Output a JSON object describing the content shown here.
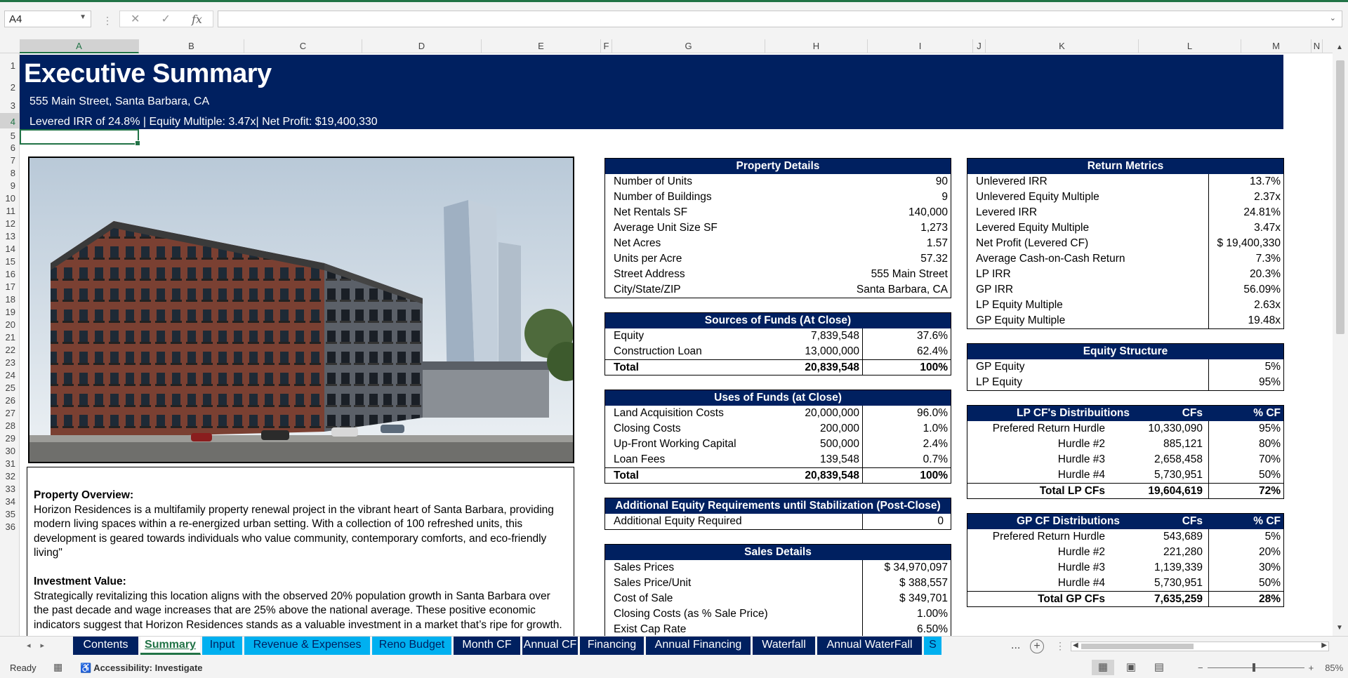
{
  "formula_bar": {
    "cell_ref": "A4",
    "cancel_icon": "✕",
    "enter_icon": "✓",
    "fx_label": "fx",
    "content": ""
  },
  "columns": [
    "A",
    "B",
    "C",
    "D",
    "E",
    "F",
    "G",
    "H",
    "I",
    "J",
    "K",
    "L",
    "M",
    "N"
  ],
  "rows": [
    "1",
    "2",
    "3",
    "4",
    "5",
    "6",
    "7",
    "8",
    "9",
    "10",
    "11",
    "12",
    "13",
    "14",
    "15",
    "16",
    "17",
    "18",
    "19",
    "20",
    "21",
    "22",
    "23",
    "24",
    "25",
    "26",
    "27",
    "28",
    "29",
    "30",
    "31",
    "32",
    "33",
    "34",
    "35",
    "36"
  ],
  "banner": {
    "title": "Executive Summary",
    "address": "555 Main Street, Santa Barbara, CA",
    "summary": "Levered IRR of 24.8% | Equity Multiple: 3.47x| Net Profit: $19,400,330"
  },
  "overview": {
    "heading": "Property Overview:",
    "body": "Horizon Residences is a multifamily property renewal project in the vibrant heart of Santa Barbara, providing modern living spaces within a re-energized urban setting. With a collection of 100 refreshed units, this development is geared towards individuals who value community, contemporary comforts, and eco-friendly living\"",
    "heading2": "Investment Value:",
    "body2": "Strategically revitalizing this location aligns with the observed 20% population growth in Santa Barbara over the past decade and wage increases that are 25% above the national average. These positive economic indicators suggest that Horizon Residences stands as a valuable investment in a market that’s ripe for growth."
  },
  "property_details": {
    "title": "Property Details",
    "rows": [
      {
        "label": "Number of Units",
        "value": "90"
      },
      {
        "label": "Number of Buildings",
        "value": "9"
      },
      {
        "label": "Net Rentals SF",
        "value": "140,000"
      },
      {
        "label": "Average Unit Size SF",
        "value": "1,273"
      },
      {
        "label": "Net Acres",
        "value": "1.57"
      },
      {
        "label": "Units per Acre",
        "value": "57.32"
      },
      {
        "label": "Street Address",
        "value": "555 Main Street"
      },
      {
        "label": "City/State/ZIP",
        "value": "Santa Barbara, CA"
      }
    ]
  },
  "sources": {
    "title": "Sources of Funds (At Close)",
    "rows": [
      {
        "label": "Equity",
        "amount": "7,839,548",
        "pct": "37.6%"
      },
      {
        "label": "Construction Loan",
        "amount": "13,000,000",
        "pct": "62.4%"
      },
      {
        "label": "Total",
        "amount": "20,839,548",
        "pct": "100%"
      }
    ]
  },
  "uses": {
    "title": "Uses of Funds (at Close)",
    "rows": [
      {
        "label": "Land Acquisition Costs",
        "amount": "20,000,000",
        "pct": "96.0%"
      },
      {
        "label": "Closing Costs",
        "amount": "200,000",
        "pct": "1.0%"
      },
      {
        "label": "Up-Front Working Capital",
        "amount": "500,000",
        "pct": "2.4%"
      },
      {
        "label": "Loan Fees",
        "amount": "139,548",
        "pct": "0.7%"
      },
      {
        "label": "Total",
        "amount": "20,839,548",
        "pct": "100%"
      }
    ]
  },
  "additional_equity": {
    "title": "Additional Equity Requirements until Stabilization (Post-Close)",
    "label": "Additional Equity Required",
    "value": "0"
  },
  "sales": {
    "title": "Sales Details",
    "rows": [
      {
        "label": "Sales Prices",
        "value": "$ 34,970,097"
      },
      {
        "label": "Sales Price/Unit",
        "value": "$ 388,557"
      },
      {
        "label": "Cost of Sale",
        "value": "$ 349,701"
      },
      {
        "label": "Closing Costs (as % Sale Price)",
        "value": "1.00%"
      },
      {
        "label": "Exist Cap Rate",
        "value": "6.50%"
      }
    ]
  },
  "returns": {
    "title": "Return Metrics",
    "rows": [
      {
        "label": "Unlevered IRR",
        "value": "13.7%"
      },
      {
        "label": "Unlevered Equity Multiple",
        "value": "2.37x"
      },
      {
        "label": "Levered IRR",
        "value": "24.81%"
      },
      {
        "label": "Levered Equity Multiple",
        "value": "3.47x"
      },
      {
        "label": "Net Profit (Levered CF)",
        "value": "$ 19,400,330"
      },
      {
        "label": "Average Cash-on-Cash Return",
        "value": "7.3%"
      },
      {
        "label": "LP IRR",
        "value": "20.3%"
      },
      {
        "label": "GP  IRR",
        "value": "56.09%"
      },
      {
        "label": "LP Equity Multiple",
        "value": "2.63x"
      },
      {
        "label": "GP Equity Multiple",
        "value": "19.48x"
      }
    ]
  },
  "equity_structure": {
    "title": "Equity Structure",
    "rows": [
      {
        "label": "GP Equity",
        "value": "5%"
      },
      {
        "label": "LP Equity",
        "value": "95%"
      }
    ]
  },
  "lp_dist": {
    "title": "LP CF's Distribuitions",
    "col_cf": "CFs",
    "col_pct": "% CF",
    "rows": [
      {
        "label": "Prefered  Return Hurdle",
        "cf": "10,330,090",
        "pct": "95%"
      },
      {
        "label": "Hurdle #2",
        "cf": "885,121",
        "pct": "80%"
      },
      {
        "label": "Hurdle #3",
        "cf": "2,658,458",
        "pct": "70%"
      },
      {
        "label": "Hurdle #4",
        "cf": "5,730,951",
        "pct": "50%"
      }
    ],
    "total": {
      "label": "Total LP CFs",
      "cf": "19,604,619",
      "pct": "72%"
    }
  },
  "gp_dist": {
    "title": "GP CF Distributions",
    "col_cf": "CFs",
    "col_pct": "% CF",
    "rows": [
      {
        "label": "Prefered  Return Hurdle",
        "cf": "543,689",
        "pct": "5%"
      },
      {
        "label": "Hurdle #2",
        "cf": "221,280",
        "pct": "20%"
      },
      {
        "label": "Hurdle #3",
        "cf": "1,139,339",
        "pct": "30%"
      },
      {
        "label": "Hurdle #4",
        "cf": "5,730,951",
        "pct": "50%"
      }
    ],
    "total": {
      "label": "Total GP CFs",
      "cf": "7,635,259",
      "pct": "28%"
    }
  },
  "tabs": [
    {
      "label": "Contents",
      "style": "navy"
    },
    {
      "label": "Summary",
      "style": "active"
    },
    {
      "label": "Input",
      "style": "cyan"
    },
    {
      "label": "Revenue & Expenses",
      "style": "cyan"
    },
    {
      "label": "Reno Budget",
      "style": "cyan"
    },
    {
      "label": "Month CF",
      "style": "navy"
    },
    {
      "label": "Annual CF",
      "style": "navy"
    },
    {
      "label": "Financing",
      "style": "navy"
    },
    {
      "label": "Annual Financing",
      "style": "navy"
    },
    {
      "label": "Waterfall",
      "style": "navy"
    },
    {
      "label": "Annual WaterFall",
      "style": "navy"
    },
    {
      "label": "S",
      "style": "cyan"
    }
  ],
  "tabs_more": "...",
  "status": {
    "ready": "Ready",
    "accessibility": "Accessibility: Investigate",
    "zoom": "85%",
    "zoom_minus": "−",
    "zoom_plus": "+"
  },
  "colors": {
    "navy": "#002060",
    "cyan": "#00b0f0",
    "excel_green": "#217346"
  }
}
